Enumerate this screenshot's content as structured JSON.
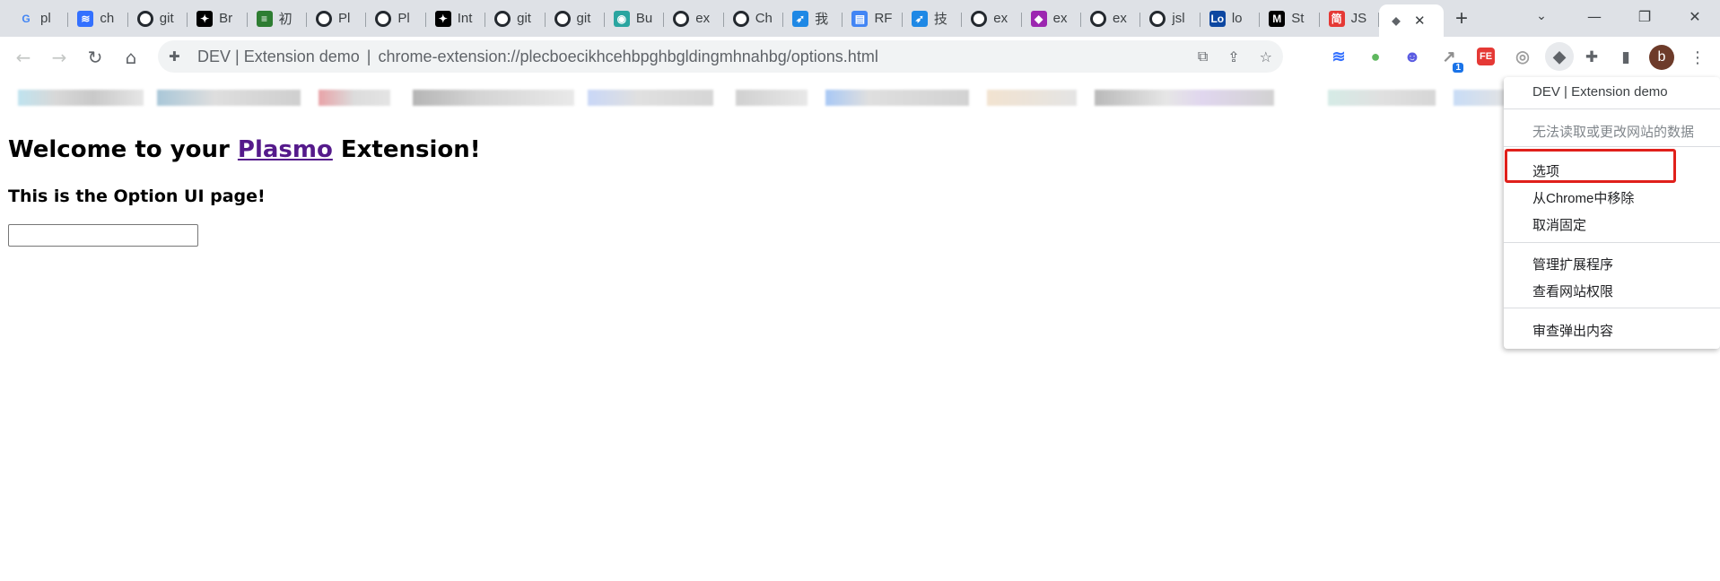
{
  "tabs": [
    {
      "label": "pl",
      "icon": "google-icon",
      "color": "#4285f4",
      "glyph": "G"
    },
    {
      "label": "ch",
      "icon": "lark-icon",
      "color": "#3370ff",
      "glyph": "≋"
    },
    {
      "label": "git",
      "icon": "github-icon",
      "color": "#24292f",
      "glyph": "●"
    },
    {
      "label": "Br",
      "icon": "plasmo-icon",
      "color": "#000000",
      "glyph": "✦"
    },
    {
      "label": "初",
      "icon": "notes-icon",
      "color": "#2e7d32",
      "glyph": "≡"
    },
    {
      "label": "Pl",
      "icon": "github-icon",
      "color": "#24292f",
      "glyph": "●"
    },
    {
      "label": "Pl",
      "icon": "github-icon",
      "color": "#24292f",
      "glyph": "●"
    },
    {
      "label": "Int",
      "icon": "plasmo-icon",
      "color": "#000000",
      "glyph": "✦"
    },
    {
      "label": "git",
      "icon": "github-icon",
      "color": "#24292f",
      "glyph": "●"
    },
    {
      "label": "git",
      "icon": "github-icon",
      "color": "#24292f",
      "glyph": "●"
    },
    {
      "label": "Bu",
      "icon": "eye-icon",
      "color": "#2aa5a0",
      "glyph": "◉"
    },
    {
      "label": "ex",
      "icon": "github-icon",
      "color": "#24292f",
      "glyph": "●"
    },
    {
      "label": "Ch",
      "icon": "github-icon",
      "color": "#24292f",
      "glyph": "●"
    },
    {
      "label": "我",
      "icon": "bird-icon",
      "color": "#1e88e5",
      "glyph": "➶"
    },
    {
      "label": "RF",
      "icon": "docs-icon",
      "color": "#4285f4",
      "glyph": "▤"
    },
    {
      "label": "技",
      "icon": "bird-icon",
      "color": "#1e88e5",
      "glyph": "➶"
    },
    {
      "label": "ex",
      "icon": "github-icon",
      "color": "#24292f",
      "glyph": "●"
    },
    {
      "label": "ex",
      "icon": "diamond-icon",
      "color": "#9c27b0",
      "glyph": "◆"
    },
    {
      "label": "ex",
      "icon": "github-icon",
      "color": "#24292f",
      "glyph": "●"
    },
    {
      "label": "jsl",
      "icon": "github-icon",
      "color": "#24292f",
      "glyph": "●"
    },
    {
      "label": "lo",
      "icon": "lo-icon",
      "color": "#0d47a1",
      "glyph": "Lo"
    },
    {
      "label": "St",
      "icon": "medium-icon",
      "color": "#000000",
      "glyph": "M"
    },
    {
      "label": "JS",
      "icon": "jian-icon",
      "color": "#e53935",
      "glyph": "简"
    }
  ],
  "active_tab": {
    "icon": "plasmo-icon",
    "close": "✕"
  },
  "new_tab": "+",
  "address_bar": {
    "origin": "DEV | Extension demo",
    "separator": "|",
    "url": "chrome-extension://plecboecikhcehbpghbgldingmhnahbg/options.html"
  },
  "extensions": [
    {
      "icon": "lark-ext-icon",
      "color": "#3370ff",
      "glyph": "≋"
    },
    {
      "icon": "green-dot-ext-icon",
      "color": "#5fb85f",
      "glyph": "●"
    },
    {
      "icon": "face-ext-icon",
      "color": "#5b5ce2",
      "glyph": "☻"
    },
    {
      "icon": "chart-ext-icon",
      "color": "#8e8e8e",
      "glyph": "↗",
      "badge": "1"
    },
    {
      "icon": "fe-ext-icon",
      "color": "#e53935",
      "glyph": "FE"
    },
    {
      "icon": "eye-ext-icon",
      "color": "#9e9e9e",
      "glyph": "◎"
    },
    {
      "icon": "plasmo-ext-icon",
      "color": "#5f6368",
      "glyph": "◆"
    }
  ],
  "profile": {
    "initial": "b"
  },
  "page": {
    "heading_prefix": "Welcome to your ",
    "heading_link": "Plasmo",
    "heading_suffix": " Extension!",
    "subheading": "This is the Option UI page!",
    "input_value": ""
  },
  "menu": {
    "title": "DEV | Extension demo",
    "no_access": "无法读取或更改网站的数据",
    "options": "选项",
    "remove": "从Chrome中移除",
    "unpin": "取消固定",
    "manage": "管理扩展程序",
    "site_permissions": "查看网站权限",
    "inspect_popup": "审查弹出内容"
  },
  "highlight_color": "#e0201b"
}
